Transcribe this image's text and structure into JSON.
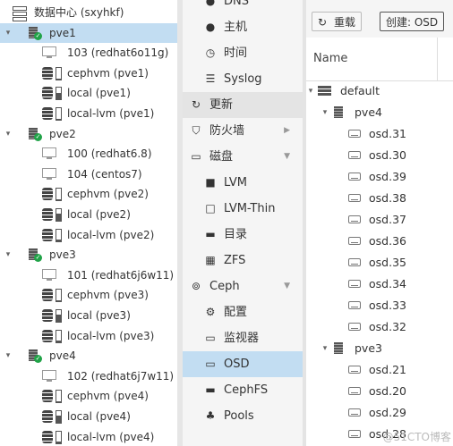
{
  "tree": {
    "datacenter": {
      "label": "数据中心 (sxyhkf)",
      "icon": "datacenter-icon"
    },
    "nodes": [
      {
        "label": "pve1",
        "selected": true,
        "children": [
          {
            "type": "vm",
            "label": "103 (redhat6o11g)"
          },
          {
            "type": "storage",
            "label": "cephvm (pve1)",
            "fill": 0.1
          },
          {
            "type": "storage",
            "label": "local (pve1)",
            "fill": 0.6
          },
          {
            "type": "storage",
            "label": "local-lvm (pve1)",
            "fill": 0.1
          }
        ]
      },
      {
        "label": "pve2",
        "selected": false,
        "children": [
          {
            "type": "vm",
            "label": "100 (redhat6.8)"
          },
          {
            "type": "vm",
            "label": "104 (centos7)"
          },
          {
            "type": "storage",
            "label": "cephvm (pve2)",
            "fill": 0.1
          },
          {
            "type": "storage",
            "label": "local (pve2)",
            "fill": 0.6
          },
          {
            "type": "storage",
            "label": "local-lvm (pve2)",
            "fill": 0.1
          }
        ]
      },
      {
        "label": "pve3",
        "selected": false,
        "children": [
          {
            "type": "vm",
            "label": "101 (redhat6j6w11)"
          },
          {
            "type": "storage",
            "label": "cephvm (pve3)",
            "fill": 0.1
          },
          {
            "type": "storage",
            "label": "local (pve3)",
            "fill": 0.6
          },
          {
            "type": "storage",
            "label": "local-lvm (pve3)",
            "fill": 0.1
          }
        ]
      },
      {
        "label": "pve4",
        "selected": false,
        "children": [
          {
            "type": "vm",
            "label": "102 (redhat6j7w11)"
          },
          {
            "type": "storage",
            "label": "cephvm (pve4)",
            "fill": 0.1
          },
          {
            "type": "storage",
            "label": "local (pve4)",
            "fill": 0.6
          },
          {
            "type": "storage",
            "label": "local-lvm (pve4)",
            "fill": 0.1
          }
        ]
      }
    ]
  },
  "menu": [
    {
      "label": "DNS",
      "icon": "globe-icon",
      "level": 1
    },
    {
      "label": "主机",
      "icon": "globe-icon",
      "level": 1
    },
    {
      "label": "时间",
      "icon": "clock-icon",
      "level": 1
    },
    {
      "label": "Syslog",
      "icon": "list-icon",
      "level": 1
    },
    {
      "label": "更新",
      "icon": "refresh-icon",
      "level": 0,
      "highlight": true
    },
    {
      "label": "防火墙",
      "icon": "shield-icon",
      "level": 0,
      "arrow": "right"
    },
    {
      "label": "磁盘",
      "icon": "hdd-icon",
      "level": 0,
      "arrow": "down"
    },
    {
      "label": "LVM",
      "icon": "square-icon",
      "level": 1
    },
    {
      "label": "LVM-Thin",
      "icon": "square-outline-icon",
      "level": 1
    },
    {
      "label": "目录",
      "icon": "folder-icon",
      "level": 1
    },
    {
      "label": "ZFS",
      "icon": "grid-icon",
      "level": 1
    },
    {
      "label": "Ceph",
      "icon": "ceph-icon",
      "level": 0,
      "arrow": "down"
    },
    {
      "label": "配置",
      "icon": "gear-icon",
      "level": 1
    },
    {
      "label": "监视器",
      "icon": "monitor-icon",
      "level": 1
    },
    {
      "label": "OSD",
      "icon": "hdd-icon",
      "level": 1,
      "selected": true
    },
    {
      "label": "CephFS",
      "icon": "folder-icon",
      "level": 1
    },
    {
      "label": "Pools",
      "icon": "sitemap-icon",
      "level": 1
    }
  ],
  "toolbar": {
    "reload_label": "重载",
    "create_label": "创建: OSD"
  },
  "grid": {
    "column_name": "Name"
  },
  "osd_tree": {
    "root": "default",
    "hosts": [
      {
        "name": "pve4",
        "osds": [
          "osd.31",
          "osd.30",
          "osd.39",
          "osd.38",
          "osd.37",
          "osd.36",
          "osd.35",
          "osd.34",
          "osd.33",
          "osd.32"
        ]
      },
      {
        "name": "pve3",
        "osds": [
          "osd.21",
          "osd.20",
          "osd.29",
          "osd.28"
        ]
      }
    ]
  },
  "watermark": "@51CTO博客"
}
